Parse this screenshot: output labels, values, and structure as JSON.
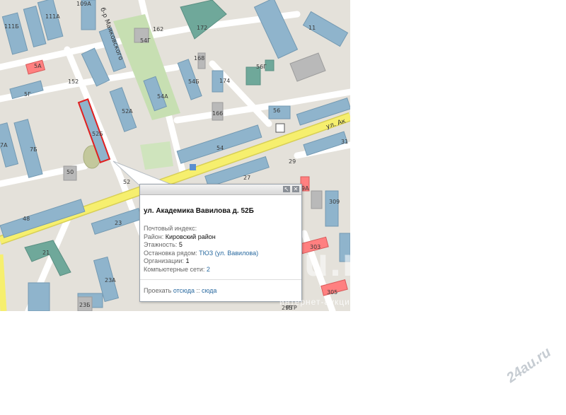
{
  "map": {
    "street_top": "ул. Ак",
    "street_vertical": "б-р Маяковского",
    "house_numbers": [
      "109А",
      "111А",
      "111Б",
      "5А",
      "5Г",
      "152",
      "162",
      "54Г",
      "172",
      "168",
      "11",
      "56Г",
      "54Б",
      "174",
      "54А",
      "52А",
      "166",
      "56",
      "52Б",
      "7А",
      "7Б",
      "50",
      "54",
      "31",
      "29",
      "27",
      "52",
      "9А",
      "309",
      "48",
      "23",
      "303",
      "21",
      "23А",
      "305",
      "23Б",
      "295"
    ],
    "street_marker_label": "ПТР"
  },
  "popup": {
    "title": "ул. Академика Вавилова д. 52Б",
    "postal_label": "Почтовый индекс:",
    "district_label": "Район:",
    "district_value": "Кировский район",
    "floors_label": "Этажность:",
    "floors_value": "5",
    "stop_label": "Остановка рядом:",
    "stop_value": "ТЮЗ (ул. Вавилова)",
    "orgs_label": "Организации:",
    "orgs_value": "1",
    "networks_label": "Компьютерные сети:",
    "networks_value": "2",
    "route_label": "Проехать",
    "route_from": "отсюда",
    "route_sep": "::",
    "route_to": "сюда",
    "btn_expand": "↖",
    "btn_close": "✕"
  },
  "watermark": {
    "text": "u.ru",
    "subtext": "интернет-аукцион",
    "corner": "24au.ru"
  },
  "colors": {
    "building_blue": "#8fb4cc",
    "building_teal": "#6fa89a",
    "building_gray": "#b9b9b9",
    "road_yellow": "#f6ef6e",
    "park_green": "#c7dfb2",
    "highlight_red": "#ff6b6b"
  }
}
